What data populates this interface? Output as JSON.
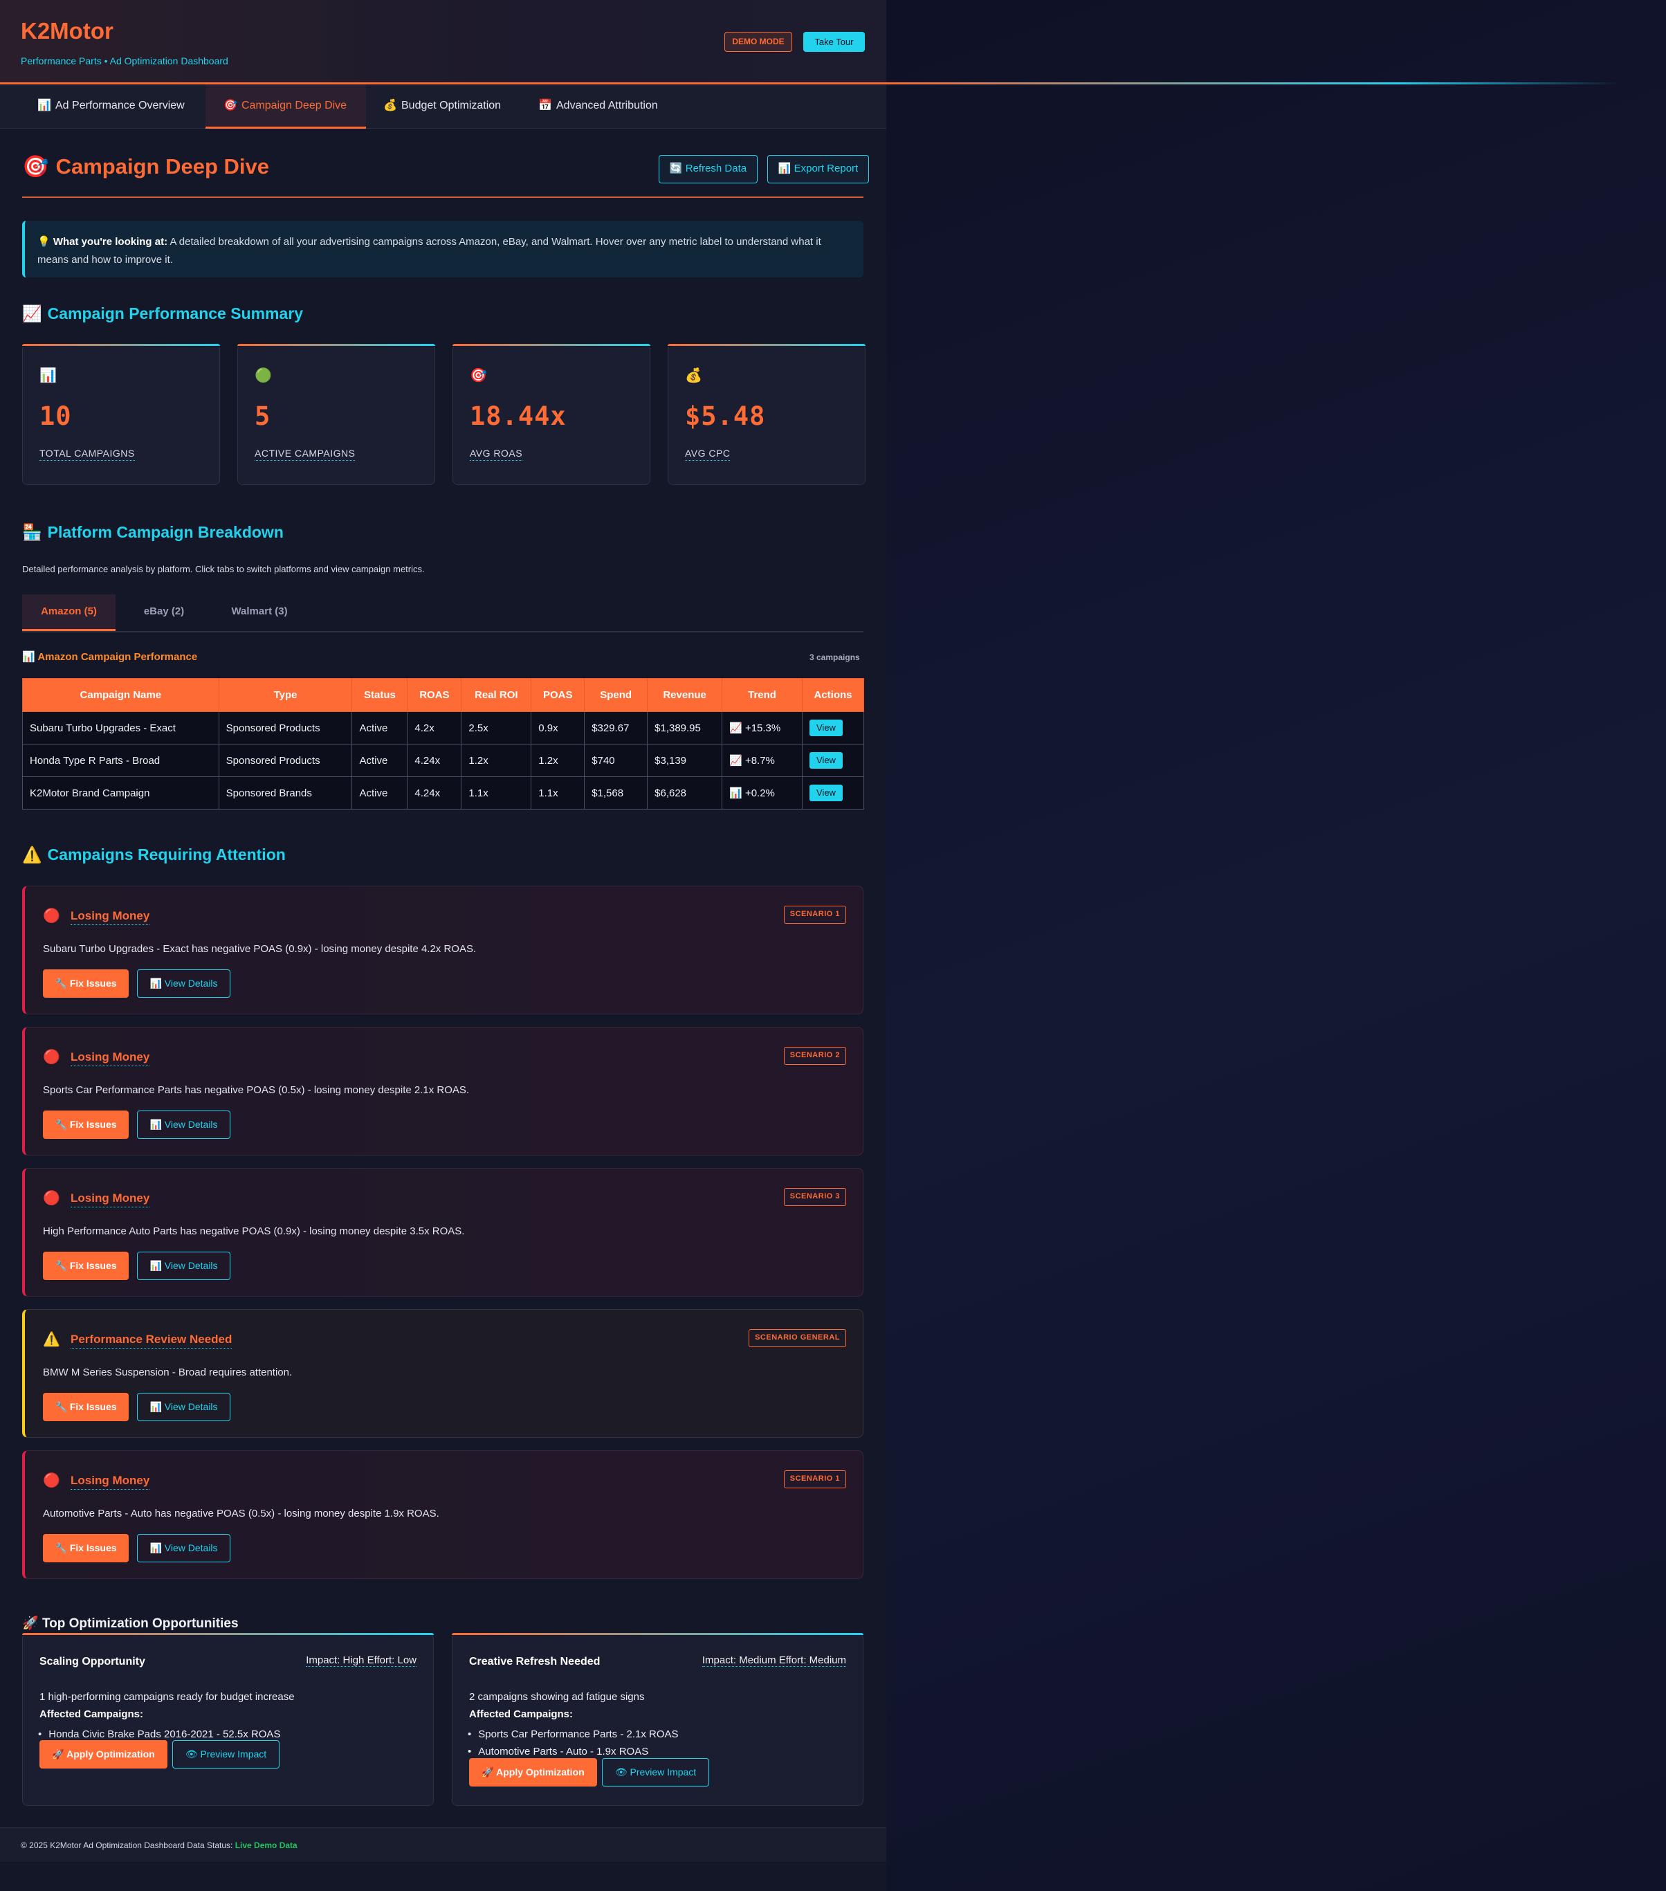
{
  "app": {
    "brand": "K2Motor",
    "tagline": "Performance Parts • Ad Optimization Dashboard",
    "demo_badge": "DEMO MODE",
    "tour_label": "Take Tour"
  },
  "nav": {
    "tabs": [
      {
        "icon": "📊",
        "label": "Ad Performance Overview"
      },
      {
        "icon": "🎯",
        "label": "Campaign Deep Dive"
      },
      {
        "icon": "💰",
        "label": "Budget Optimization"
      },
      {
        "icon": "📅",
        "label": "Advanced Attribution"
      }
    ]
  },
  "page": {
    "icon": "🎯",
    "title": "Campaign Deep Dive",
    "refresh_label": "Refresh Data",
    "refresh_icon": "🔄",
    "export_label": "Export Report",
    "export_icon": "📊"
  },
  "info": {
    "icon": "💡",
    "lead": "What you're looking at:",
    "strong_text": "A detailed breakdown of all your advertising campaigns across Amazon, eBay, and Walmart.",
    "text": "Hover over any metric label to understand what it means and how to improve it."
  },
  "summary": {
    "icon": "📈",
    "title": "Campaign Performance Summary",
    "cards": [
      {
        "icon": "📊",
        "value": "10",
        "label": "TOTAL CAMPAIGNS"
      },
      {
        "icon": "🟢",
        "value": "5",
        "label": "ACTIVE CAMPAIGNS"
      },
      {
        "icon": "🎯",
        "value": "18.44x",
        "label": "AVG ROAS"
      },
      {
        "icon": "💰",
        "value": "$5.48",
        "label": "AVG CPC"
      }
    ]
  },
  "breakdown": {
    "icon": "🏪",
    "title": "Platform Campaign Breakdown",
    "description": "Detailed performance analysis by platform. Click tabs to switch platforms and view campaign metrics.",
    "tabs": [
      "Amazon (5)",
      "eBay (2)",
      "Walmart (3)"
    ],
    "table_icon": "📊",
    "table_title": "Amazon Campaign Performance",
    "table_count": "3 campaigns",
    "columns": [
      "Campaign Name",
      "Type",
      "Status",
      "ROAS",
      "Real ROI",
      "POAS",
      "Spend",
      "Revenue",
      "Trend",
      "Actions"
    ],
    "rows": [
      {
        "name": "Subaru Turbo Upgrades - Exact",
        "type": "Sponsored Products",
        "status": "Active",
        "roas": "4.2x",
        "roi": "2.5x",
        "poas": "0.9x",
        "spend": "$329.67",
        "revenue": "$1,389.95",
        "trend_icon": "📈",
        "trend": "+15.3%",
        "action": "View"
      },
      {
        "name": "Honda Type R Parts - Broad",
        "type": "Sponsored Products",
        "status": "Active",
        "roas": "4.24x",
        "roi": "1.2x",
        "poas": "1.2x",
        "spend": "$740",
        "revenue": "$3,139",
        "trend_icon": "📈",
        "trend": "+8.7%",
        "action": "View"
      },
      {
        "name": "K2Motor Brand Campaign",
        "type": "Sponsored Brands",
        "status": "Active",
        "roas": "4.24x",
        "roi": "1.1x",
        "poas": "1.1x",
        "spend": "$1,568",
        "revenue": "$6,628",
        "trend_icon": "📊",
        "trend": "+0.2%",
        "action": "View"
      }
    ]
  },
  "attention": {
    "icon": "⚠️",
    "title": "Campaigns Requiring Attention",
    "fix_label": "Fix Issues",
    "fix_icon": "🔧",
    "details_label": "View Details",
    "details_icon": "📊",
    "alerts": [
      {
        "severity": "critical",
        "icon": "🔴",
        "title": "Losing Money",
        "badge": "SCENARIO 1",
        "message": "Subaru Turbo Upgrades - Exact has negative POAS (0.9x) - losing money despite 4.2x ROAS."
      },
      {
        "severity": "critical",
        "icon": "🔴",
        "title": "Losing Money",
        "badge": "SCENARIO 2",
        "message": "Sports Car Performance Parts has negative POAS (0.5x) - losing money despite 2.1x ROAS."
      },
      {
        "severity": "critical",
        "icon": "🔴",
        "title": "Losing Money",
        "badge": "SCENARIO 3",
        "message": "High Performance Auto Parts has negative POAS (0.9x) - losing money despite 3.5x ROAS."
      },
      {
        "severity": "warning",
        "icon": "⚠️",
        "title": "Performance Review Needed",
        "badge": "SCENARIO GENERAL",
        "message": "BMW M Series Suspension - Broad requires attention."
      },
      {
        "severity": "critical",
        "icon": "🔴",
        "title": "Losing Money",
        "badge": "SCENARIO 1",
        "message": "Automotive Parts - Auto has negative POAS (0.5x) - losing money despite 1.9x ROAS."
      }
    ]
  },
  "opportunities": {
    "icon": "🚀",
    "title": "Top Optimization Opportunities",
    "affected_label": "Affected Campaigns:",
    "apply_label": "Apply Optimization",
    "apply_icon": "🚀",
    "preview_label": "Preview Impact",
    "preview_icon": "👁",
    "cards": [
      {
        "title": "Scaling Opportunity",
        "impact": "Impact: High Effort: Low",
        "description": "1 high-performing campaigns ready for budget increase",
        "campaigns": [
          "Honda Civic Brake Pads 2016-2021 - 52.5x ROAS"
        ]
      },
      {
        "title": "Creative Refresh Needed",
        "impact": "Impact: Medium Effort: Medium",
        "description": "2 campaigns showing ad fatigue signs",
        "campaigns": [
          "Sports Car Performance Parts - 2.1x ROAS",
          "Automotive Parts - Auto - 1.9x ROAS"
        ]
      }
    ]
  },
  "footer": {
    "text": "© 2025 K2Motor Ad Optimization Dashboard Data Status:",
    "status": "Live Demo Data"
  },
  "colors": {
    "accent": "#ff6b35",
    "secondary": "#22d3ee",
    "critical": "#e11d48",
    "warning": "#facc15",
    "live": "#22c55e"
  }
}
